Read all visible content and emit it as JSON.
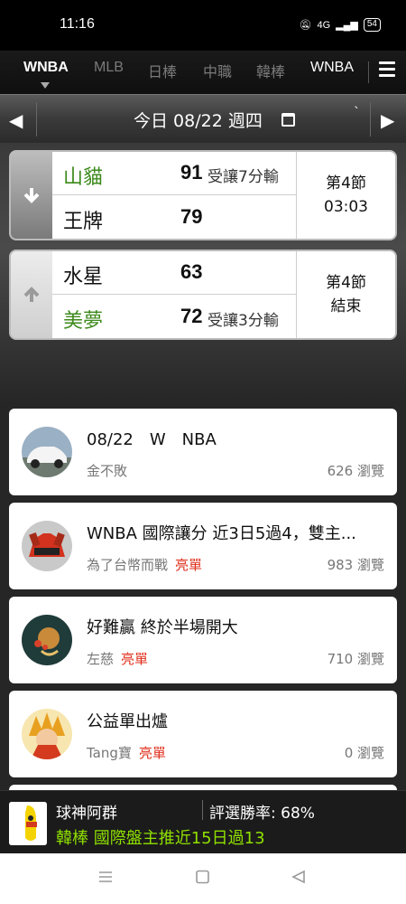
{
  "status_bar": {
    "time": "11:16",
    "network": "4G",
    "battery": "54"
  },
  "tabs": [
    {
      "label": "WNBA",
      "active": true
    },
    {
      "label": "MLB",
      "active": false
    },
    {
      "label": "日棒",
      "active": false
    },
    {
      "label": "中職",
      "active": false
    },
    {
      "label": "韓棒",
      "active": false
    },
    {
      "label": "WNBA",
      "active": false
    }
  ],
  "date_bar": {
    "label": "今日 08/22 週四",
    "tick": "`"
  },
  "games": [
    {
      "home": {
        "name": "山貓",
        "score": "91",
        "note": "受讓7分輸",
        "color": "green"
      },
      "away": {
        "name": "王牌",
        "score": "79",
        "note": "",
        "color": "black"
      },
      "period": "第4節",
      "clock": "03:03",
      "side_icon": "arrow-down-icon"
    },
    {
      "home": {
        "name": "水星",
        "score": "63",
        "note": "",
        "color": "black"
      },
      "away": {
        "name": "美夢",
        "score": "72",
        "note": "受讓3分輸",
        "color": "green"
      },
      "period": "第4節",
      "clock": "結束",
      "side_icon": "arrow-up-icon"
    }
  ],
  "articles": [
    {
      "title": "08/22　W　NBA",
      "author": "金不敗",
      "badge": "",
      "views": "626 瀏覽",
      "avatar": "car-avatar"
    },
    {
      "title": "WNBA 國際讓分 近3日5過4，雙主...",
      "author": "為了台幣而戰",
      "badge": "亮單",
      "views": "983 瀏覽",
      "avatar": "sportscar-avatar"
    },
    {
      "title": "好難贏 終於半場開大",
      "author": "左慈",
      "badge": "亮單",
      "views": "710 瀏覽",
      "avatar": "character-avatar"
    },
    {
      "title": "公益單出爐",
      "author": "Tang寶",
      "badge": "亮單",
      "views": "0 瀏覽",
      "avatar": "anime-avatar"
    }
  ],
  "banner": {
    "name": "球神阿群",
    "rate": "評選勝率: 68%",
    "pick": "韓棒 國際盤主推近15日過13",
    "logo_text": "今天好運"
  },
  "colors": {
    "accent_green": "#3c8a1c",
    "badge_red": "#e0301e",
    "pick_green": "#8fe000"
  }
}
